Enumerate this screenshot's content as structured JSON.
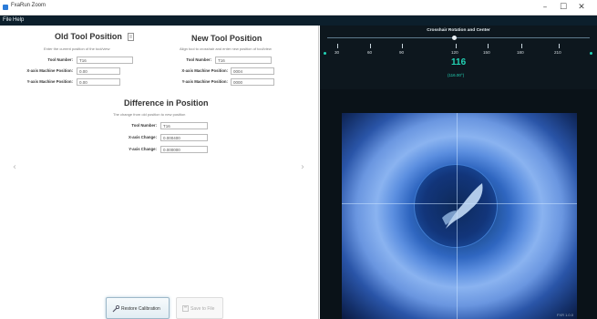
{
  "window": {
    "title": "FxaRun Zoom",
    "minimize_glyph": "–",
    "maximize_glyph": "☐",
    "close_glyph": "✕"
  },
  "menu": [
    "File",
    "Help"
  ],
  "old_tool": {
    "title": "Old Tool Position",
    "description": "Enter the current position of the tool/view",
    "tool_number_label": "Tool Number:",
    "tool_number_value": "T16",
    "x_label": "X-axis Machine Position:",
    "x_value": "0.00",
    "y_label": "Y-axis Machine Position:",
    "y_value": "0.00"
  },
  "new_tool": {
    "title": "New Tool Position",
    "description": "Align tool to crosshair and enter new position of tool/view",
    "tool_number_label": "Tool Number:",
    "tool_number_value": "T16",
    "x_label": "X-axis Machine Position:",
    "x_value": "0004",
    "y_label": "Y-axis Machine Position:",
    "y_value": "0000"
  },
  "difference": {
    "title": "Difference in Position",
    "description": "The change from old position to new position",
    "tool_number_label": "Tool Number:",
    "tool_number_value": "T16",
    "x_label": "X-axis Change:",
    "x_value": "0.000400",
    "y_label": "Y-axis Change:",
    "y_value": "0.000000"
  },
  "buttons": {
    "restore": "Restore Calibration",
    "save": "Save to File"
  },
  "ruler": {
    "title": "Crosshair Rotation and Center",
    "ticks": [
      "30",
      "60",
      "90",
      "120",
      "150",
      "180",
      "210"
    ],
    "current_value": "116",
    "current_sub": "(116.00°)"
  },
  "camera": {
    "stamp": "FXR 1.0.0"
  },
  "icons": {
    "question": "question-icon",
    "restore": "wrench-icon",
    "save": "save-icon",
    "prev": "chevron-left-icon",
    "next": "chevron-right-icon"
  },
  "colors": {
    "menubar": "#0c1f2c",
    "accent": "#22d3b5",
    "camera_glow": "#8ab3f0"
  }
}
